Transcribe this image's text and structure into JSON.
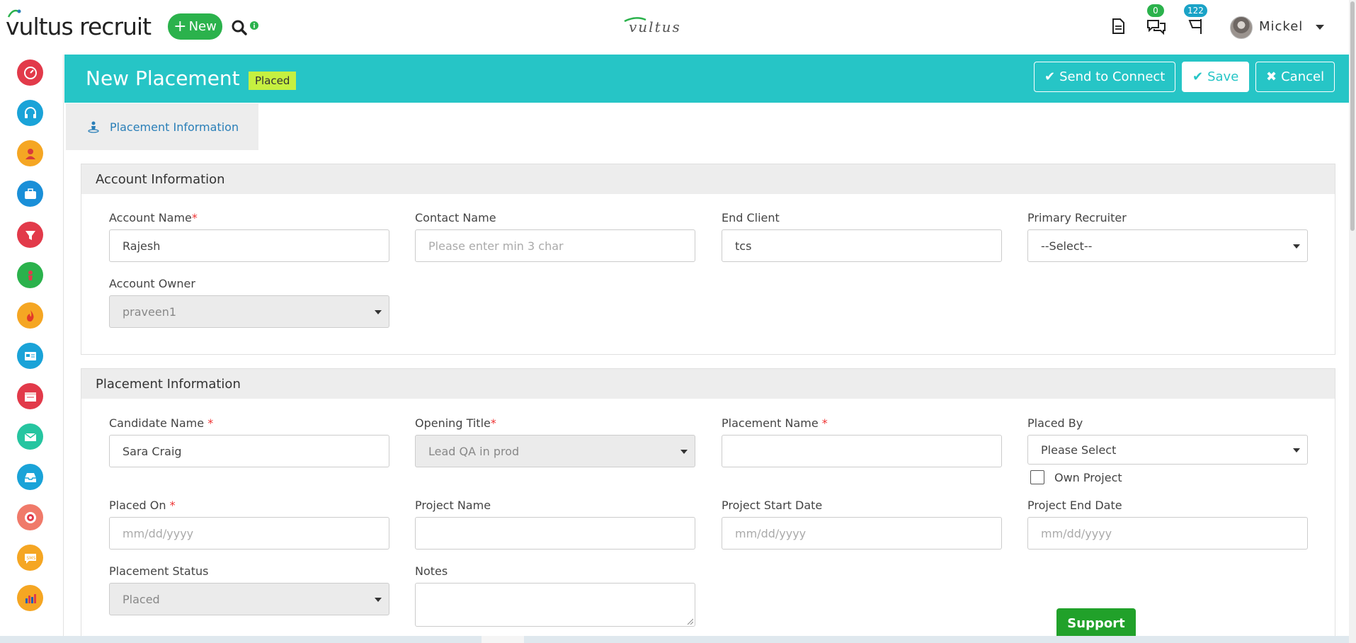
{
  "app": {
    "brand": "vultus recruit",
    "center_logo": "vultus",
    "new_label": "New",
    "chat_count": "0",
    "flag_count": "122",
    "user_name": "Mickel",
    "colors": {
      "teal": "#26c5c6",
      "green": "#2bb24c",
      "badge_blue": "#1aa3c7",
      "status_badge": "#c6f040"
    }
  },
  "header": {
    "title": "New Placement",
    "status": "Placed",
    "send_label": "Send to Connect",
    "save_label": "Save",
    "cancel_label": "Cancel"
  },
  "tab": {
    "label": "Placement Information"
  },
  "account": {
    "heading": "Account Information",
    "account_name_label": "Account Name",
    "account_name_value": "Rajesh",
    "contact_name_label": "Contact Name",
    "contact_name_placeholder": "Please enter min 3 char",
    "end_client_label": "End Client",
    "end_client_value": "tcs",
    "primary_recruiter_label": "Primary Recruiter",
    "primary_recruiter_value": "--Select--",
    "account_owner_label": "Account Owner",
    "account_owner_value": "praveen1"
  },
  "placement": {
    "heading": "Placement Information",
    "candidate_name_label": "Candidate Name",
    "candidate_name_value": "Sara Craig",
    "opening_title_label": "Opening Title",
    "opening_title_value": "Lead QA in prod",
    "placement_name_label": "Placement Name",
    "placement_name_value": "",
    "placed_by_label": "Placed By",
    "placed_by_value": "Please Select",
    "own_project_label": "Own Project",
    "placed_on_label": "Placed On",
    "placed_on_placeholder": "mm/dd/yyyy",
    "project_name_label": "Project Name",
    "project_start_label": "Project Start Date",
    "project_start_placeholder": "mm/dd/yyyy",
    "project_end_label": "Project End Date",
    "project_end_placeholder": "mm/dd/yyyy",
    "status_label": "Placement Status",
    "status_value": "Placed",
    "notes_label": "Notes"
  },
  "support_label": "Support",
  "sidebar_icons": [
    "dashboard-icon",
    "support-headset-icon",
    "contacts-icon",
    "jobs-briefcase-icon",
    "funnel-icon",
    "placement-icon",
    "hot-list-icon",
    "job-board-icon",
    "calendar-icon",
    "email-icon",
    "inbox-icon",
    "target-icon",
    "sms-icon",
    "reports-icon"
  ]
}
